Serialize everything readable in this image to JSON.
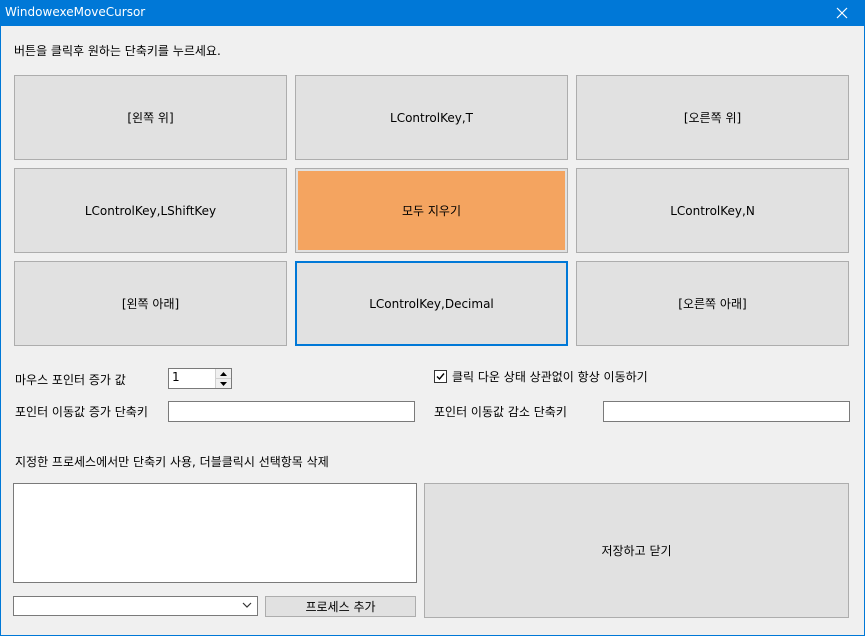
{
  "window": {
    "title": "WindowexeMoveCursor"
  },
  "instruction": "버튼을 클릭후 원하는 단축키를 누르세요.",
  "grid_buttons": [
    {
      "label": "[왼쪽 위]"
    },
    {
      "label": "LControlKey,T"
    },
    {
      "label": "[오른쪽 위]"
    },
    {
      "label": "LControlKey,LShiftKey"
    },
    {
      "label": "모두 지우기"
    },
    {
      "label": "LControlKey,N"
    },
    {
      "label": "[왼쪽 아래]"
    },
    {
      "label": "LControlKey,Decimal"
    },
    {
      "label": "[오른쪽 아래]"
    }
  ],
  "colors": {
    "titlebar": "#0078d7",
    "clear_button": "#f4a460",
    "focus_border": "#0078d7"
  },
  "pointer_increment": {
    "label": "마우스 포인터 증가 값",
    "value": "1"
  },
  "always_move": {
    "label": "클릭 다운 상태 상관없이 항상 이동하기",
    "checked": true
  },
  "increase_shortcut": {
    "label": "포인터 이동값 증가 단축키",
    "value": ""
  },
  "decrease_shortcut": {
    "label": "포인터 이동값 감소 단축키",
    "value": ""
  },
  "process_section": {
    "label": "지정한 프로세스에서만 단축키 사용, 더블클릭시 선택항목 삭제"
  },
  "process_combo": {
    "value": ""
  },
  "add_process_button": "프로세스 추가",
  "save_close_button": "저장하고 닫기"
}
